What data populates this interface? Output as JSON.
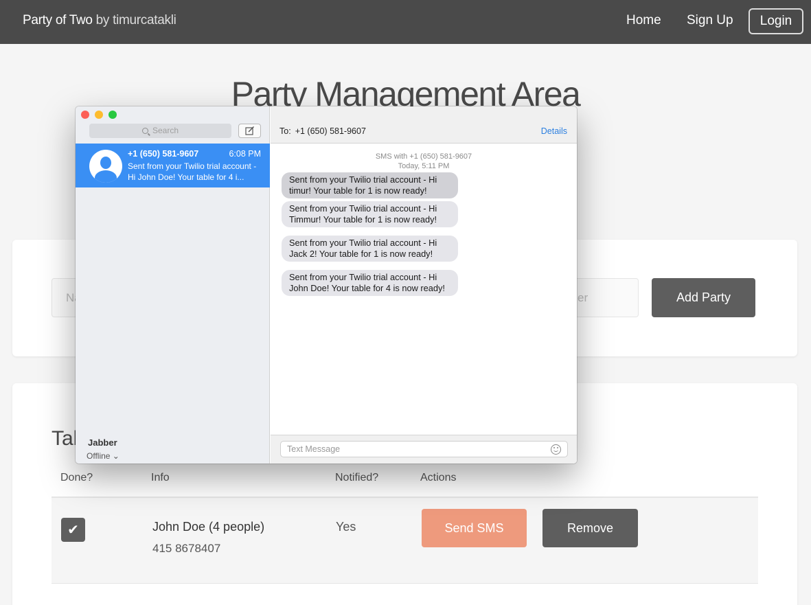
{
  "navbar": {
    "brand": "Party of Two",
    "brand_by": "by timurcatakli",
    "home": "Home",
    "signup": "Sign Up",
    "login": "Login"
  },
  "page": {
    "title": "Party Management Area"
  },
  "add_form": {
    "name_placeholder": "Na",
    "phone_placeholder": "er",
    "add_button": "Add Party"
  },
  "table": {
    "title": "Tab",
    "headers": [
      "Done?",
      "Info",
      "Notified?",
      "Actions"
    ],
    "rows": [
      {
        "done": true,
        "name": "John Doe (4 people)",
        "phone": "415 8678407",
        "notified": "Yes",
        "send_label": "Send SMS",
        "remove_label": "Remove"
      }
    ]
  },
  "messages_app": {
    "search_placeholder": "Search",
    "conversation": {
      "name": "+1 (650) 581-9607",
      "time": "6:08 PM",
      "preview": "Sent from your Twilio trial account - Hi John Doe! Your table for 4 i..."
    },
    "account_name": "Jabber",
    "account_status": "Offline ⌄",
    "to_label": "To:",
    "to_value": "+1 (650) 581-9607",
    "details": "Details",
    "meta_line1": "SMS with +1 (650) 581-9607",
    "meta_line2": "Today, 5:11 PM",
    "messages": [
      "Sent from your Twilio trial account - Hi timur! Your table for 1 is now ready!",
      "Sent from your Twilio trial account - Hi Timmur! Your table for 1 is now ready!",
      "Sent from your Twilio trial account - Hi Jack 2! Your table for 1 is now ready!",
      "Sent from your Twilio trial account - Hi John Doe! Your table for 4 is now ready!"
    ],
    "input_placeholder": "Text Message"
  },
  "colors": {
    "navbar": "#4a4a4a",
    "send_sms": "#ee9a7d",
    "dark_button": "#5e5e5e",
    "selected_conversation": "#3a8ff4"
  }
}
